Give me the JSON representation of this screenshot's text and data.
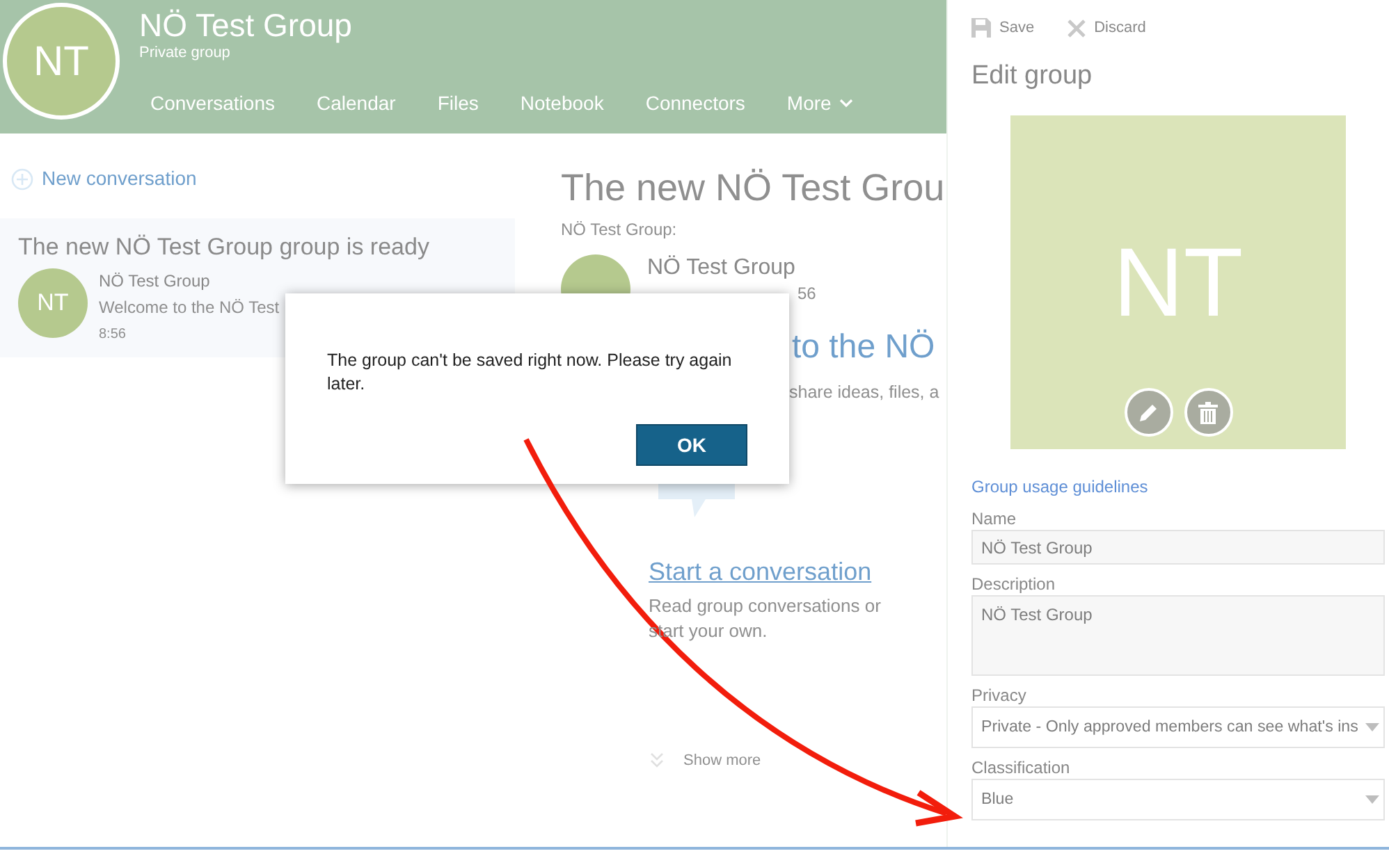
{
  "header": {
    "avatar": "NT",
    "title": "NÖ Test Group",
    "subtitle": "Private group",
    "tabs": [
      {
        "label": "Conversations",
        "kind": "link"
      },
      {
        "label": "Calendar",
        "kind": "link"
      },
      {
        "label": "Files",
        "kind": "link"
      },
      {
        "label": "Notebook",
        "kind": "link"
      },
      {
        "label": "Connectors",
        "kind": "link"
      },
      {
        "label": "More",
        "kind": "menu"
      }
    ]
  },
  "conversations": {
    "new_conversation": "New conversation",
    "thread": {
      "title": "The new NÖ Test Group group is ready",
      "avatar": "NT",
      "sender": "NÖ Test Group",
      "preview": "Welcome to the NÖ Test",
      "time": "8:56"
    }
  },
  "message": {
    "title": "The new NÖ Test Grou",
    "from": "NÖ Test Group:",
    "sender": "NÖ Test Group",
    "time": "56",
    "welcome": "to the NÖ",
    "intro": "share ideas, files, a",
    "start_link": "Start a conversation",
    "start_text": "Read group conversations or start your own.",
    "show_more": "Show more"
  },
  "edit_panel": {
    "actions": [
      {
        "label": "Save",
        "kind": "save"
      },
      {
        "label": "Discard",
        "kind": "discard"
      }
    ],
    "title": "Edit group",
    "photo": "NT",
    "guidelines": "Group usage guidelines",
    "fields": [
      {
        "label": "Name",
        "kind": "text",
        "value": "NÖ Test Group"
      },
      {
        "label": "Description",
        "kind": "textarea",
        "value": "NÖ Test Group"
      },
      {
        "label": "Privacy",
        "kind": "select",
        "value": "Private - Only approved members can see what's ins"
      },
      {
        "label": "Classification",
        "kind": "select",
        "value": "Blue"
      }
    ]
  },
  "dialog": {
    "message": "The group can't be saved right now. Please try again later.",
    "button": "OK"
  }
}
